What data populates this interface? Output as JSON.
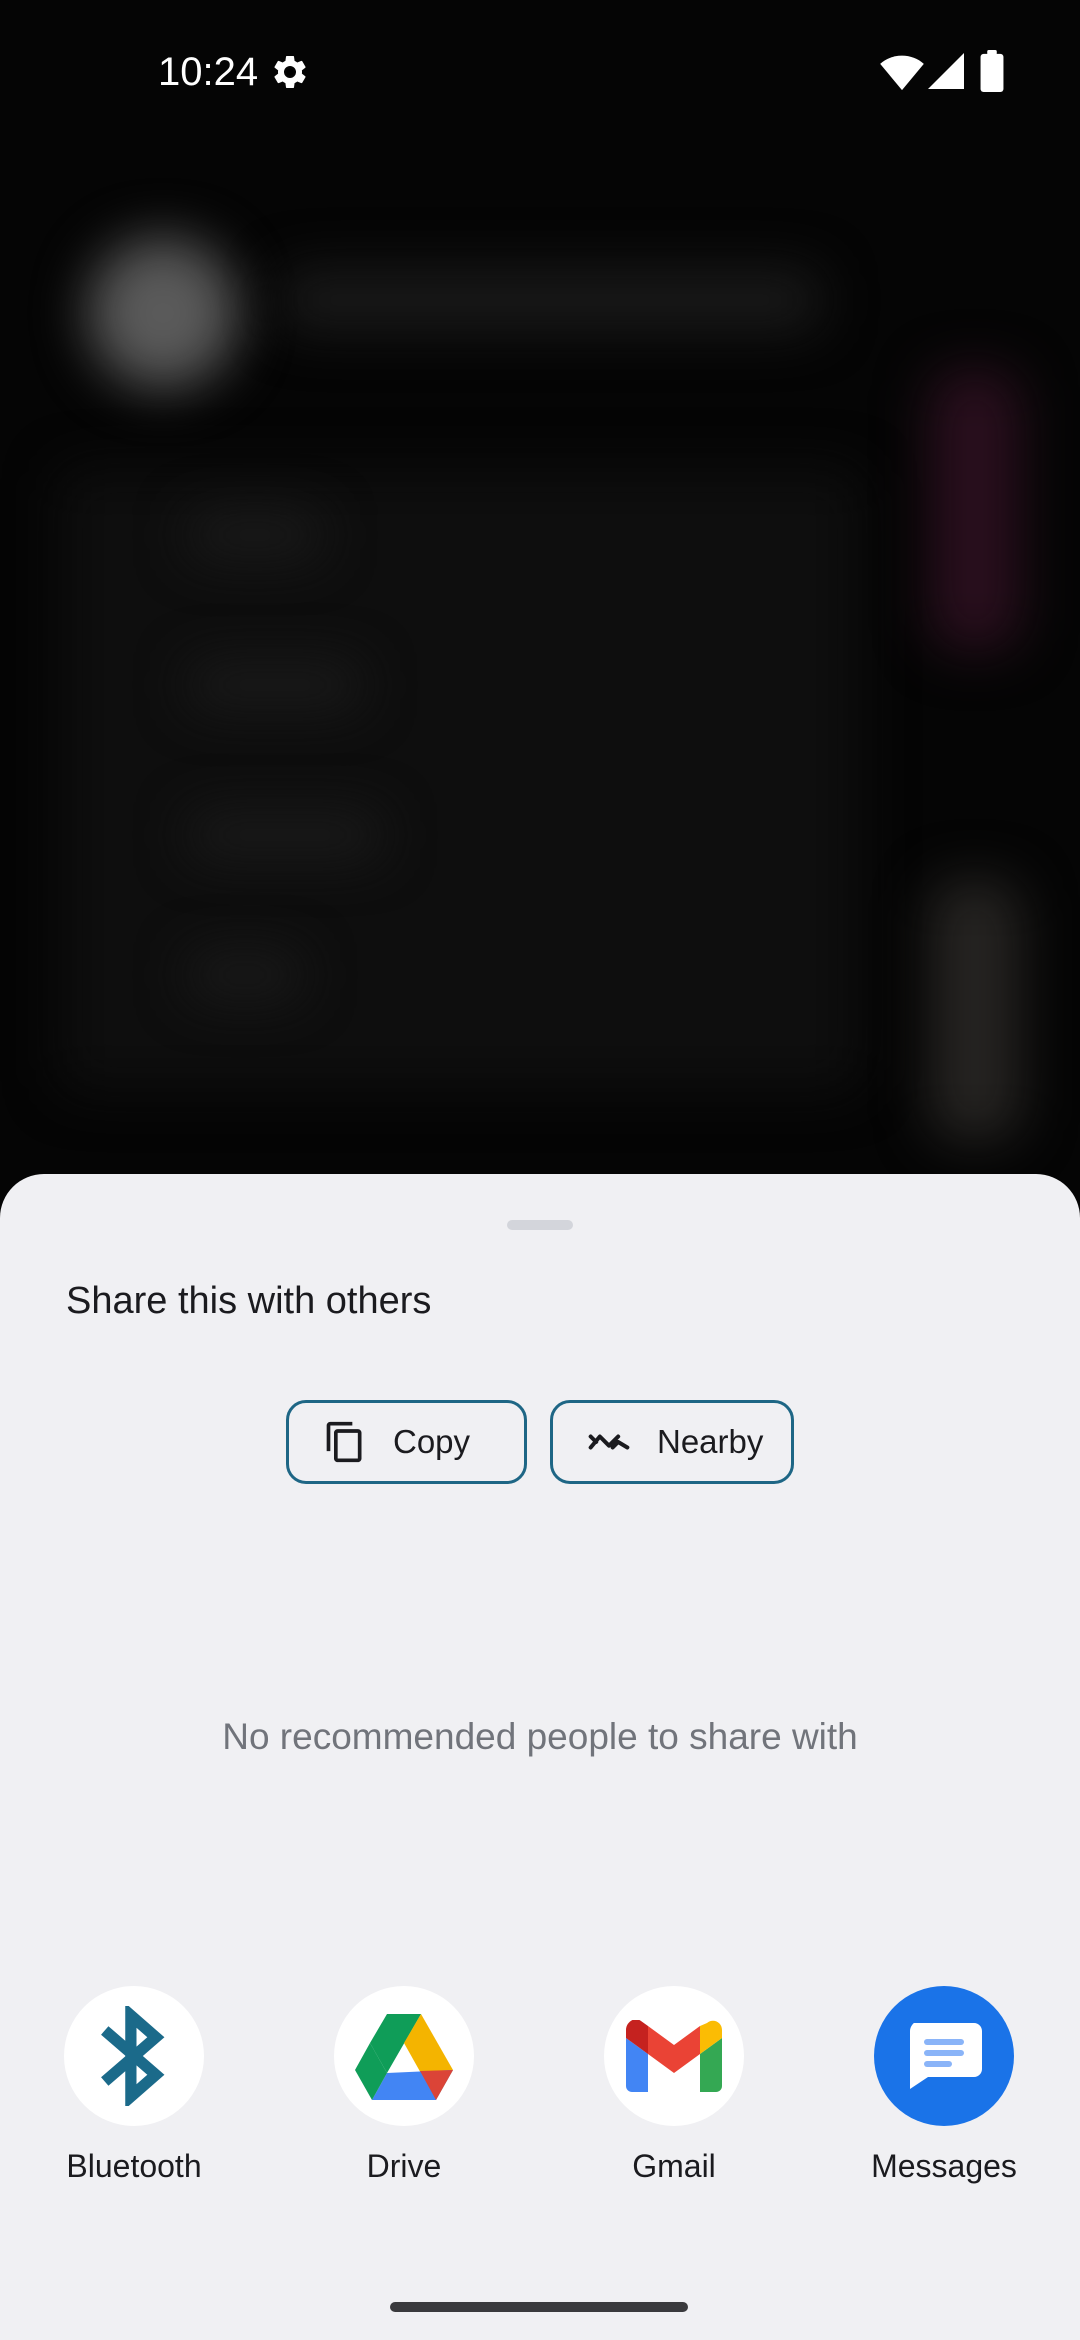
{
  "status_bar": {
    "time": "10:24",
    "icons": [
      "gear-icon",
      "wifi-icon",
      "cell-signal-icon",
      "battery-icon"
    ]
  },
  "share_sheet": {
    "title": "Share this with others",
    "actions": [
      {
        "label": "Copy",
        "icon": "copy-icon"
      },
      {
        "label": "Nearby",
        "icon": "nearby-share-icon"
      }
    ],
    "empty_message": "No recommended people to share with",
    "apps": [
      {
        "label": "Bluetooth",
        "icon": "bluetooth-icon"
      },
      {
        "label": "Drive",
        "icon": "google-drive-icon"
      },
      {
        "label": "Gmail",
        "icon": "gmail-icon"
      },
      {
        "label": "Messages",
        "icon": "messages-icon"
      }
    ]
  },
  "colors": {
    "sheet_background": "#f0f0f3",
    "chip_border": "#1e6685",
    "bluetooth": "#1b6a8a",
    "messages": "#1a73e8",
    "secondary_text": "#71747b"
  }
}
